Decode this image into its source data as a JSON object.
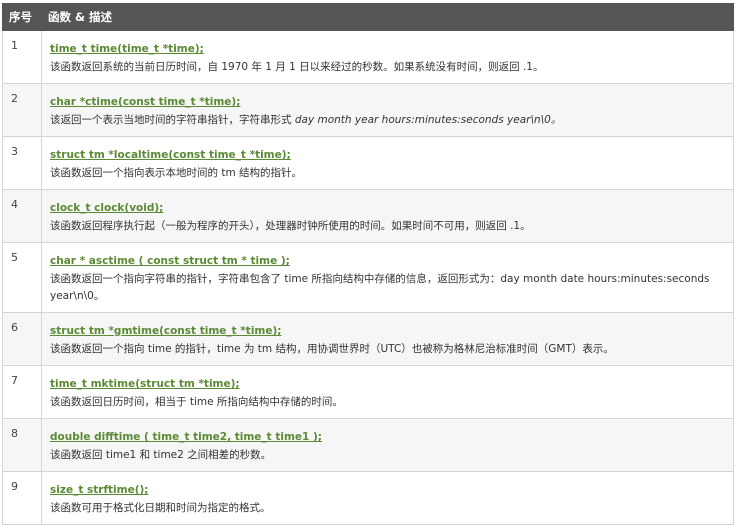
{
  "header": {
    "num": "序号",
    "desc": "函数 & 描述"
  },
  "rows": [
    {
      "num": "1",
      "sig": "time_t time(time_t *time);",
      "desc": "该函数返回系统的当前日历时间，自 1970 年 1 月 1 日以来经过的秒数。如果系统没有时间，则返回 .1。",
      "desc_tail": ""
    },
    {
      "num": "2",
      "sig": "char *ctime(const time_t *time);",
      "desc": "该返回一个表示当地时间的字符串指针，字符串形式 ",
      "desc_tail": "day month year hours:minutes:seconds year\\n\\0。"
    },
    {
      "num": "3",
      "sig": "struct tm *localtime(const time_t *time);",
      "desc": "该函数返回一个指向表示本地时间的 tm 结构的指针。",
      "desc_tail": ""
    },
    {
      "num": "4",
      "sig": "clock_t clock(void);",
      "desc": "该函数返回程序执行起（一般为程序的开头），处理器时钟所使用的时间。如果时间不可用，则返回 .1。",
      "desc_tail": ""
    },
    {
      "num": "5",
      "sig": "char * asctime ( const struct tm * time );",
      "desc": "该函数返回一个指向字符串的指针，字符串包含了 time 所指向结构中存储的信息，返回形式为：day month date hours:minutes:seconds year\\n\\0。",
      "desc_tail": ""
    },
    {
      "num": "6",
      "sig": "struct tm *gmtime(const time_t *time);",
      "desc": "该函数返回一个指向 time 的指针，time 为 tm 结构，用协调世界时（UTC）也被称为格林尼治标准时间（GMT）表示。",
      "desc_tail": ""
    },
    {
      "num": "7",
      "sig": "time_t mktime(struct tm *time);",
      "desc": "该函数返回日历时间，相当于 time 所指向结构中存储的时间。",
      "desc_tail": ""
    },
    {
      "num": "8",
      "sig": "double difftime ( time_t time2, time_t time1 );",
      "desc": "该函数返回 time1 和 time2 之间相差的秒数。",
      "desc_tail": ""
    },
    {
      "num": "9",
      "sig": "size_t strftime();",
      "desc": "该函数可用于格式化日期和时间为指定的格式。",
      "desc_tail": ""
    }
  ]
}
